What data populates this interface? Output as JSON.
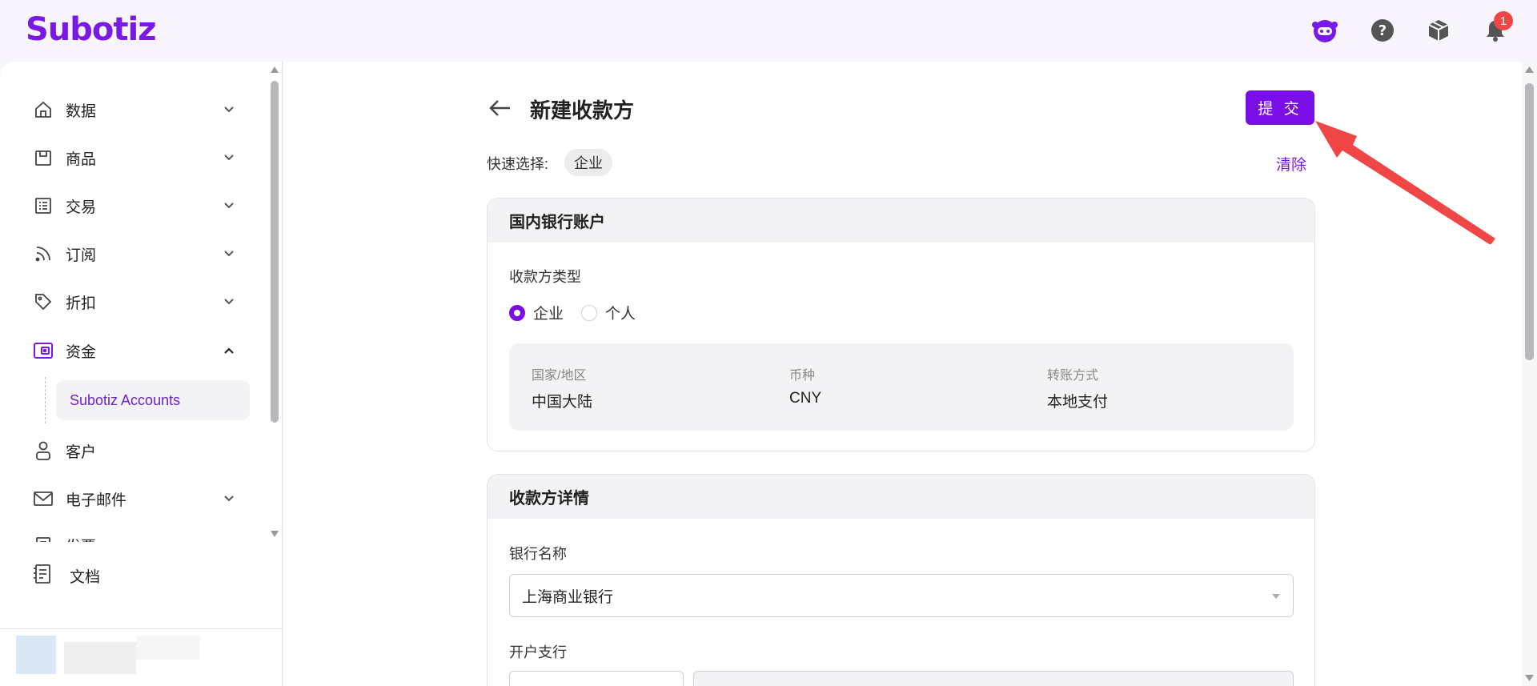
{
  "header": {
    "logo": "Subotiz",
    "notification_count": "1"
  },
  "sidebar": {
    "items": [
      {
        "label": "数据",
        "icon": "home-icon"
      },
      {
        "label": "商品",
        "icon": "store-icon"
      },
      {
        "label": "交易",
        "icon": "list-icon"
      },
      {
        "label": "订阅",
        "icon": "rss-icon"
      },
      {
        "label": "折扣",
        "icon": "tag-icon"
      },
      {
        "label": "资金",
        "icon": "wallet-icon"
      },
      {
        "label": "客户",
        "icon": "user-icon"
      },
      {
        "label": "电子邮件",
        "icon": "mail-icon"
      },
      {
        "label": "发票",
        "icon": "invoice-icon"
      }
    ],
    "active_sub": "Subotiz Accounts",
    "docs_label": "文档"
  },
  "page": {
    "title": "新建收款方",
    "submit_label": "提 交",
    "quick_select_label": "快速选择:",
    "quick_chip": "企业",
    "clear_label": "清除"
  },
  "bank_card": {
    "title": "国内银行账户",
    "payee_type_label": "收款方类型",
    "options": [
      "企业",
      "个人"
    ],
    "selected_option": "企业",
    "country_key": "国家/地区",
    "country_value": "中国大陆",
    "currency_key": "币种",
    "currency_value": "CNY",
    "method_key": "转账方式",
    "method_value": "本地支付"
  },
  "details_card": {
    "title": "收款方详情",
    "bank_name_label": "银行名称",
    "bank_name_value": "上海商业银行",
    "branch_label": "开户支行"
  },
  "colors": {
    "accent": "#7a0ee6",
    "annotation": "#f04646"
  }
}
